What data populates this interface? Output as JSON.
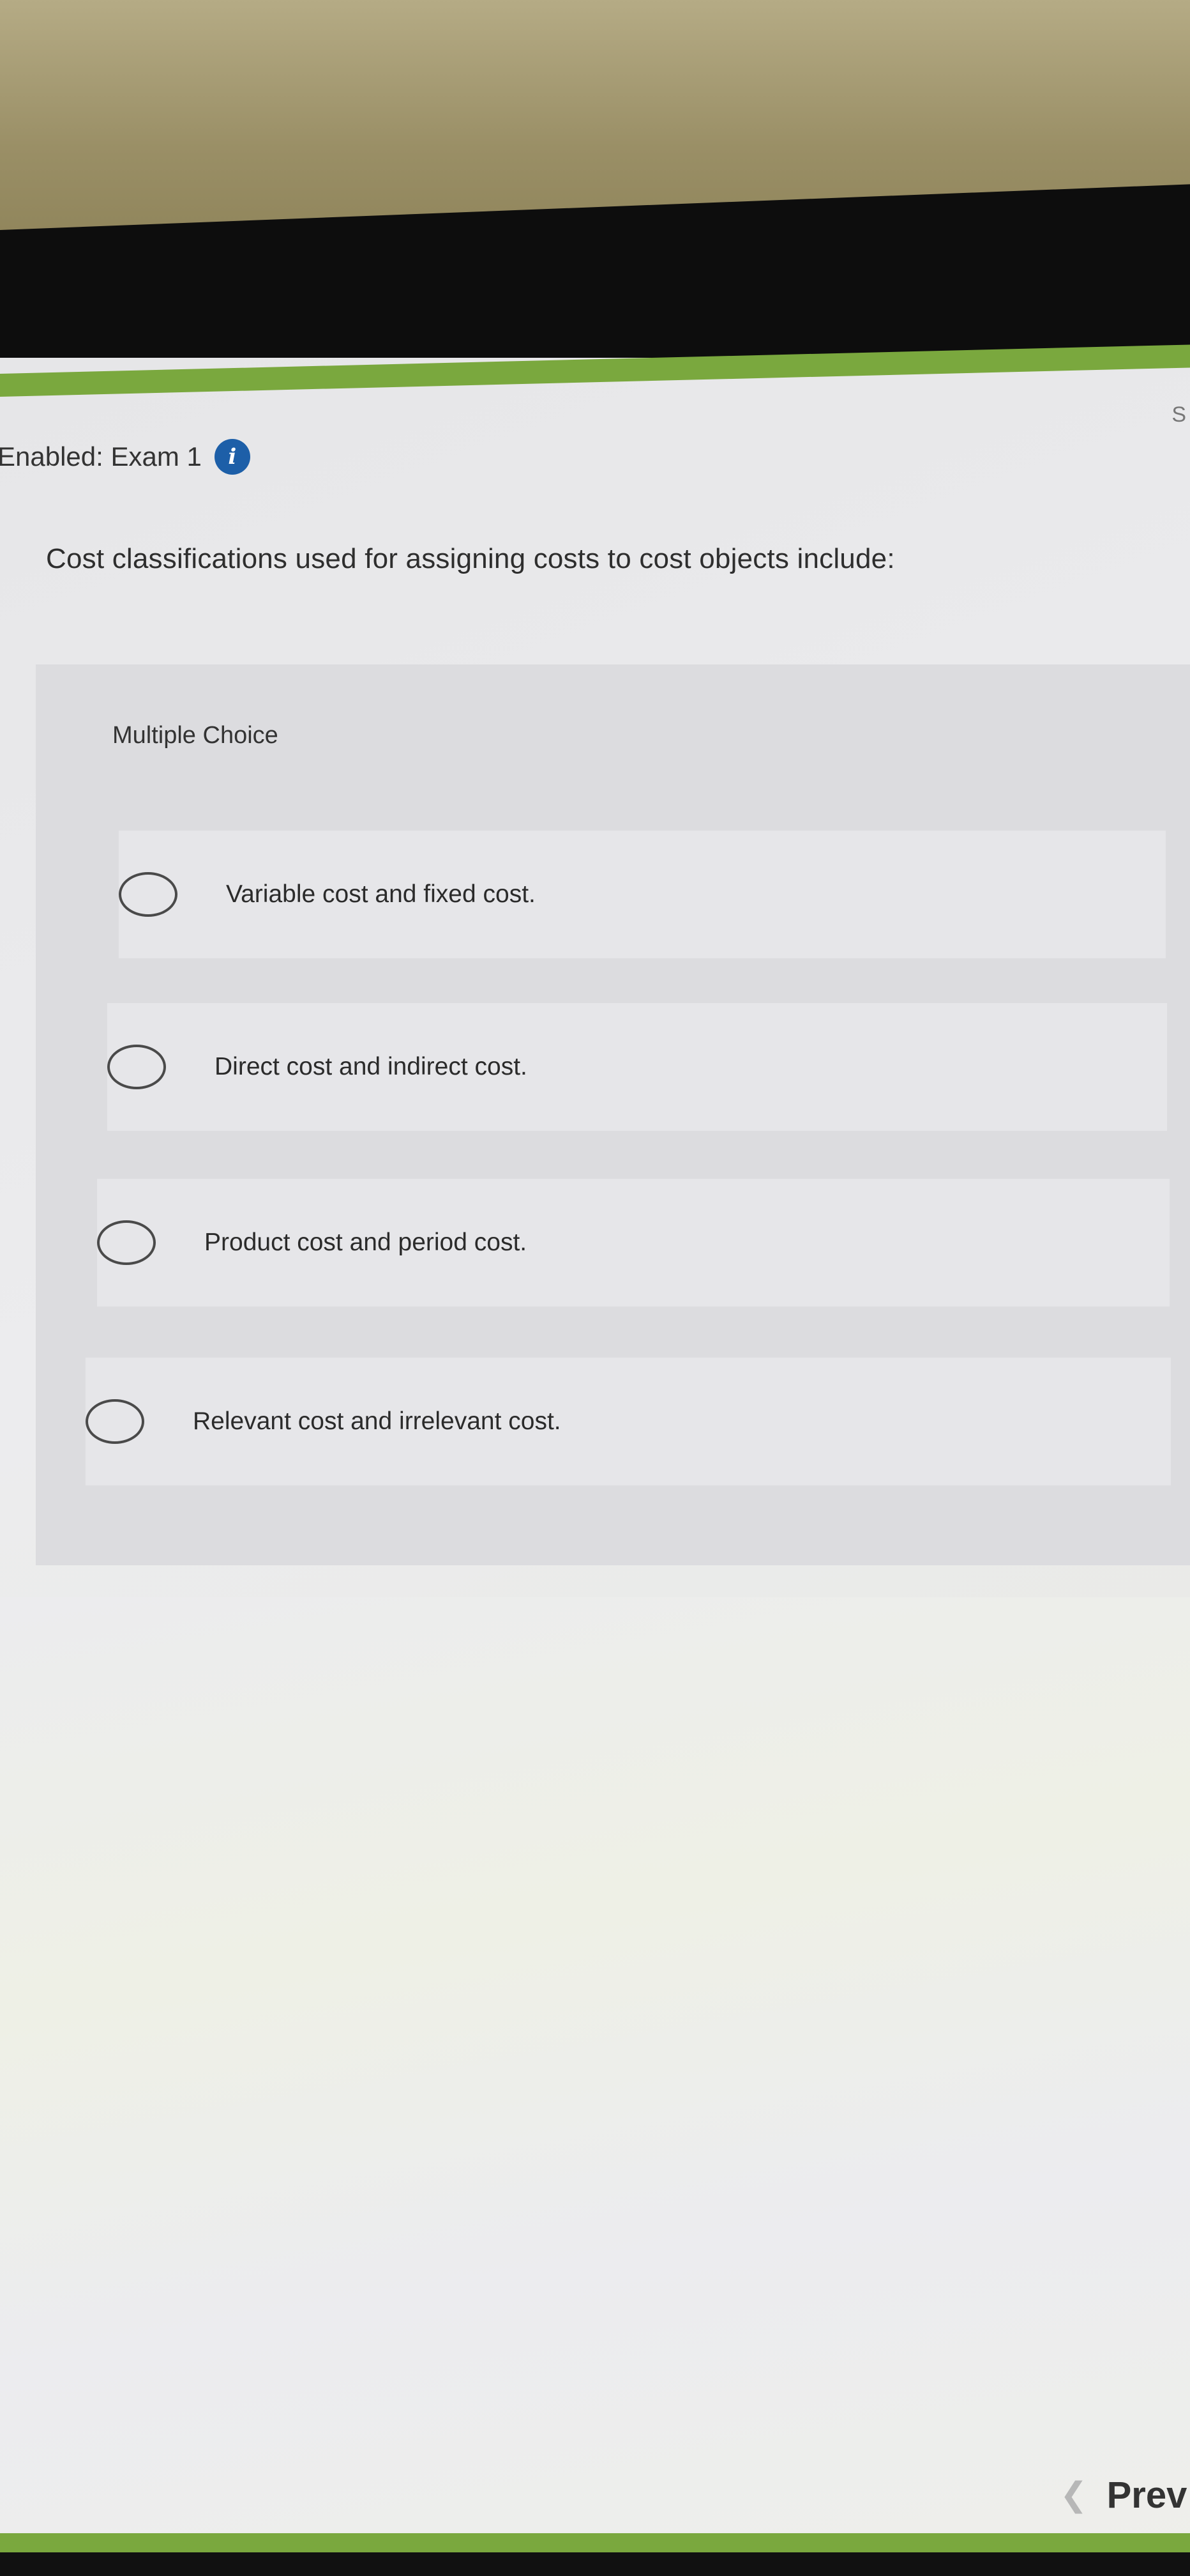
{
  "header": {
    "title": "Enabled: Exam 1",
    "info_icon_glyph": "i",
    "corner_letter": "S"
  },
  "question": {
    "text": "Cost classifications used for assigning costs to cost objects include:"
  },
  "choices": {
    "label": "Multiple Choice",
    "options": [
      {
        "label": "Variable cost and fixed cost."
      },
      {
        "label": "Direct cost and indirect cost."
      },
      {
        "label": "Product cost and period cost."
      },
      {
        "label": "Relevant cost and irrelevant cost."
      }
    ]
  },
  "nav": {
    "prev_label": "Prev",
    "prev_icon": "chevron-left-icon"
  },
  "colors": {
    "accent_green": "#7aa83e",
    "info_blue": "#1d5fa8"
  }
}
